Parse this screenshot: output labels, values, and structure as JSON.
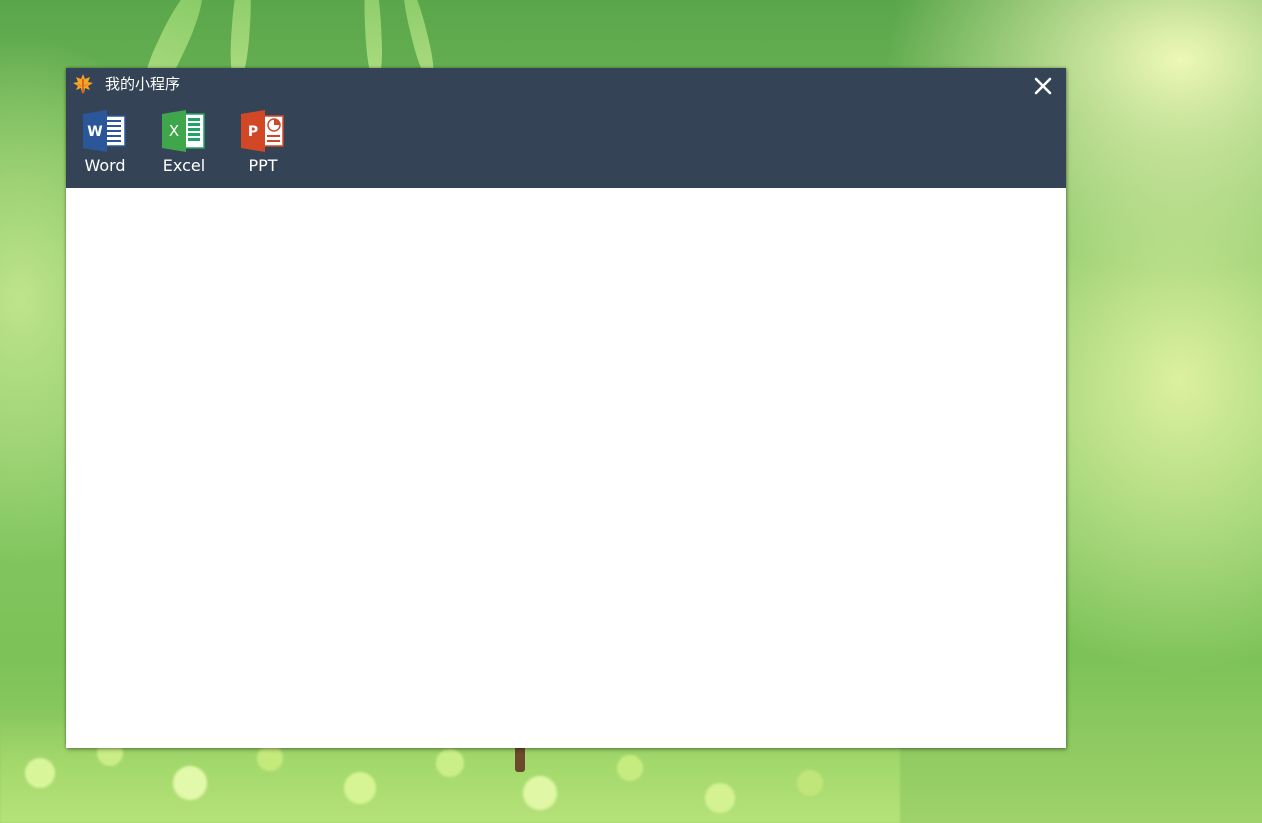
{
  "window": {
    "title": "我的小程序",
    "app_icon": "maple-leaf-icon",
    "close_icon": "close-icon"
  },
  "toolbar": {
    "items": [
      {
        "label": "Word",
        "icon": "word-icon",
        "color": "#2b579a"
      },
      {
        "label": "Excel",
        "icon": "excel-icon",
        "color": "#21a366"
      },
      {
        "label": "PPT",
        "icon": "powerpoint-icon",
        "color": "#d24726"
      }
    ]
  },
  "colors": {
    "header_bg": "#344456",
    "content_bg": "#ffffff"
  }
}
